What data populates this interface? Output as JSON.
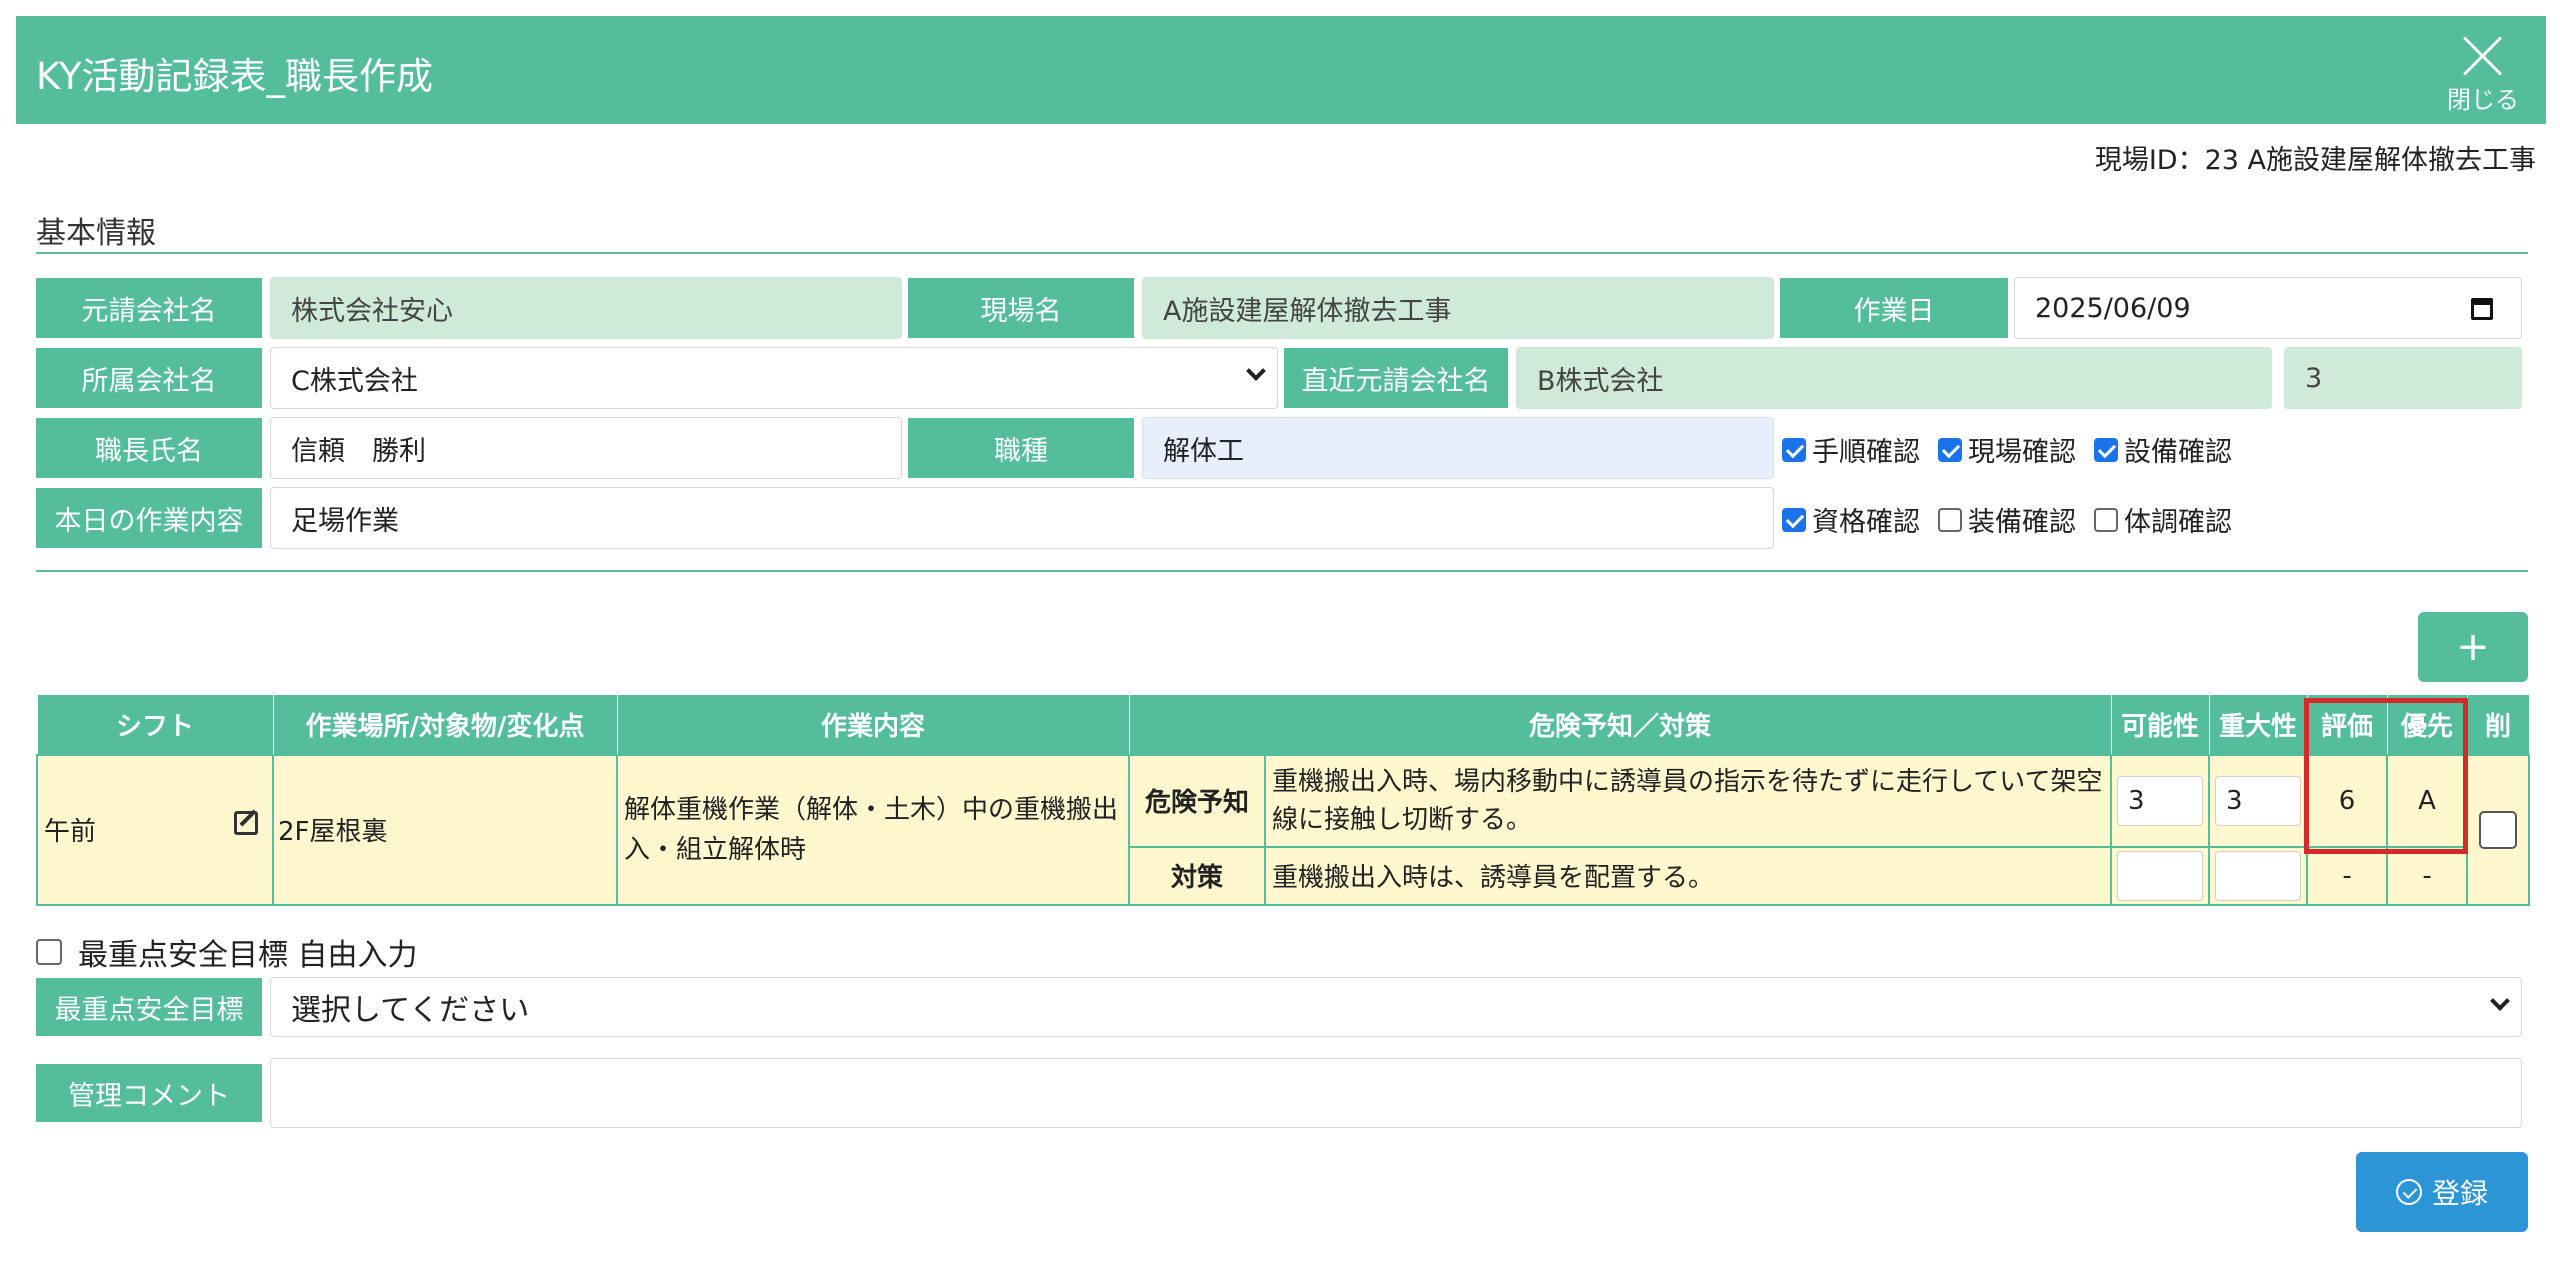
{
  "header": {
    "title": "KY活動記録表_職長作成",
    "close_label": "閉じる"
  },
  "site_id": "現場ID：23 A施設建屋解体撤去工事",
  "basic_info": {
    "title": "基本情報",
    "prime_contractor_label": "元請会社名",
    "prime_contractor_value": "株式会社安心",
    "site_name_label": "現場名",
    "site_name_value": "A施設建屋解体撤去工事",
    "work_date_label": "作業日",
    "work_date_value": "2025/06/09",
    "company_label": "所属会社名",
    "company_value": "C株式会社",
    "direct_contractor_label": "直近元請会社名",
    "direct_contractor_value": "B株式会社",
    "direct_contractor_tier": "3",
    "foreman_label": "職長氏名",
    "foreman_value": "信頼　勝利",
    "trade_label": "職種",
    "trade_value": "解体工",
    "work_content_label": "本日の作業内容",
    "work_content_value": "足場作業",
    "checks_row1": [
      {
        "label": "手順確認",
        "checked": true
      },
      {
        "label": "現場確認",
        "checked": true
      },
      {
        "label": "設備確認",
        "checked": true
      }
    ],
    "checks_row2": [
      {
        "label": "資格確認",
        "checked": true
      },
      {
        "label": "装備確認",
        "checked": false
      },
      {
        "label": "体調確認",
        "checked": false
      }
    ]
  },
  "add_button": "+",
  "table": {
    "headers": [
      "シフト",
      "作業場所/対象物/変化点",
      "作業内容",
      "危険予知／対策",
      "可能性",
      "重大性",
      "評価",
      "優先",
      "削"
    ],
    "row": {
      "shift": "午前",
      "place": "2F屋根裏",
      "work": "解体重機作業（解体・土木）中の重機搬出入・組立解体時",
      "danger_label": "危険予知",
      "danger_text": "重機搬出入時、場内移動中に誘導員の指示を待たずに走行していて架空線に接触し切断する。",
      "measure_label": "対策",
      "measure_text": "重機搬出入時は、誘導員を配置する。",
      "possibility": "3",
      "severity": "3",
      "evaluation": "6",
      "priority": "A",
      "measure_possibility": "",
      "measure_severity": "",
      "measure_evaluation": "-",
      "measure_priority": "-"
    }
  },
  "free_input_label": "最重点安全目標 自由入力",
  "safety_goal_label": "最重点安全目標",
  "safety_goal_value": "選択してください",
  "comment_label": "管理コメント",
  "comment_value": "",
  "register_button": "登録"
}
